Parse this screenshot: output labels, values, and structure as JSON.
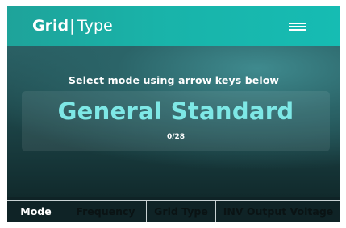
{
  "header": {
    "title_strong": "Grid",
    "separator": "|",
    "title_light": "Type",
    "menu_icon": "hamburger-menu-icon"
  },
  "main": {
    "instruction": "Select mode using arrow keys below",
    "selected_mode": "General Standard",
    "counter": "0/28"
  },
  "tabs": [
    {
      "label": "Mode",
      "active": true
    },
    {
      "label": "Frequency",
      "active": false
    },
    {
      "label": "Grid Type",
      "active": false
    },
    {
      "label": "INV Output Voltage",
      "active": false
    }
  ],
  "colors": {
    "header_accent": "#19b3a9",
    "mode_value": "#7ee8e6",
    "background_dark": "#0f2326"
  }
}
